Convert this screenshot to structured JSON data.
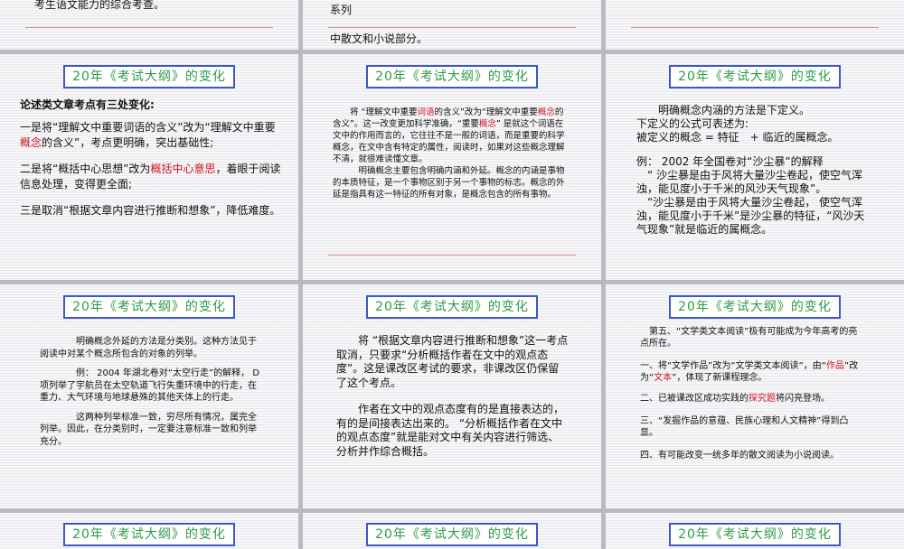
{
  "title": "20年《考试大纲》的变化",
  "s00": {
    "line": "考生语文能力的综合考查。"
  },
  "s01": {
    "line1": "系列",
    "line2": "中散文和小说部分。"
  },
  "s10": {
    "intro": "论述类文章考点有三处变化:",
    "p1a": "一是将“理解文中重要词语的含义”改为“理解文中重要",
    "p1red": "概念",
    "p1b": "的含义”，考点更明确，突出基础性;",
    "p2a": "二是将“概括中心思想”改为",
    "p2red": "概括中心意思",
    "p2b": "，着眼于阅读信息处理，变得更全面;",
    "p3": "三是取消“根据文章内容进行推断和想象”，降低难度。"
  },
  "s11": {
    "a1": "将 “理解文中重要",
    "a1red": "词语",
    "a1b": "的含义”改为“理解文中重要",
    "a1red2": "概念",
    "a1c": "的含义”。这一改变更加科学准确，“重要",
    "a1red3": "概念",
    "a1d": "” 是就这个词语在文中的作用而言的，它往往不是一般的词语，而是重要的科学概念，在文中含有特定的属性，阅读时，如果对这些概念理解不清，就很难读懂文章。",
    "a2": "明确概念主要包含明确内涵和外延。概念的内涵是事物的本质特征，是一个事物区别于另一个事物的标志。概念的外延是指具有这一特征的所有对象，是概念包含的所有事物。"
  },
  "s12": {
    "l1": "明确概念内涵的方法是下定义。",
    "l2": "下定义的公式可表述为:",
    "l3": "被定义的概念 = 特征　+ 临近的属概念。",
    "ex": "例： 2002 年全国卷对“沙尘暴”的解释",
    "q1": "“ 沙尘暴是由于风将大量沙尘卷起，使空气浑浊，能见度小于千米的风沙天气现象”。",
    "q2": "“沙尘暴是由于风将大量沙尘卷起， 使空气浑浊，能见度小于千米”是沙尘暴的特征，“风沙天气现象”就是临近的属概念。"
  },
  "s20": {
    "p1": "明确概念外延的方法是分类别。这种方法见于阅读中对某个概念所包含的对象的列举。",
    "p2": "例： 2004 年湖北卷对“太空行走”的解释， D 项列举了宇航员在太空轨道飞行失重环境中的行走，在重力、大气环境与地球悬殊的其他天体上的行走。",
    "p3": "这两种列举标准一致，穷尽所有情况，属完全列举。因此，在分类别时，一定要注意标准一致和列举充分。"
  },
  "s21": {
    "p1": "将 “根据文章内容进行推断和想象”这一考点取消，只要求“分析概括作者在文中的观点态度”。这是课改区考试的要求，非课改区仍保留了这个考点。",
    "p2": "作者在文中的观点态度有的是直接表达的，有的是间接表达出来的。 “分析概括作者在文中的观点态度”就是能对文中有关内容进行筛选、分析并作综合概括。"
  },
  "s22": {
    "intro": "第五、“文学类文本阅读”极有可能成为今年高考的亮点所在。",
    "i1a": "一、将“文学作品”改为“文学类文本阅读”，由“",
    "i1red": "作品",
    "i1b": "”改为“",
    "i1red2": "文本",
    "i1c": "”，体现了新课程理念。",
    "i2a": "二、已被课改区成功实践的",
    "i2red": "探究题",
    "i2b": "将闪亮登场。",
    "i3": "三、“发掘作品的意蕴、民族心理和人文精神”得到凸显。",
    "i4": "四、有可能改变一统多年的散文阅读为小说阅读。"
  }
}
